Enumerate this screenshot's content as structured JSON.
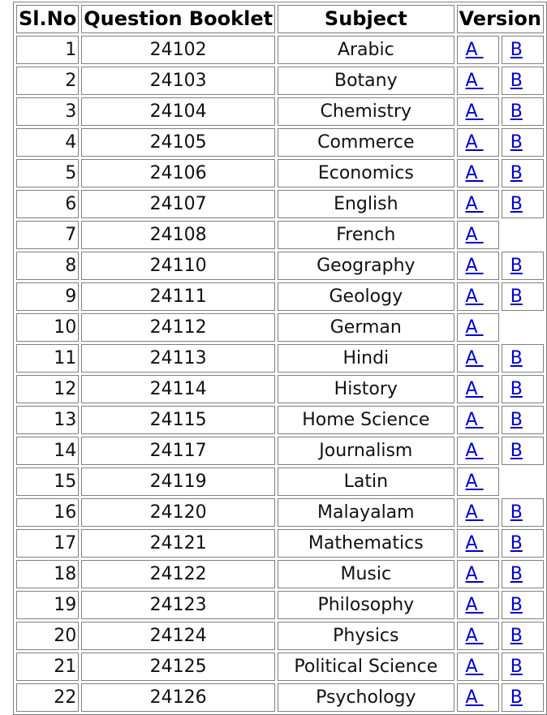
{
  "table": {
    "headers": {
      "sl_no": "Sl.No",
      "question_booklet": "Question Booklet",
      "subject": "Subject",
      "version": "Version"
    },
    "link_color": "#0000cc",
    "rows": [
      {
        "sl": "1",
        "booklet": "24102",
        "subject": "Arabic",
        "a": "A ",
        "b": "B"
      },
      {
        "sl": "2",
        "booklet": "24103",
        "subject": "Botany",
        "a": "A ",
        "b": "B"
      },
      {
        "sl": "3",
        "booklet": "24104",
        "subject": "Chemistry",
        "a": "A ",
        "b": "B"
      },
      {
        "sl": "4",
        "booklet": "24105",
        "subject": "Commerce",
        "a": "A ",
        "b": "B"
      },
      {
        "sl": "5",
        "booklet": "24106",
        "subject": "Economics",
        "a": "A ",
        "b": "B"
      },
      {
        "sl": "6",
        "booklet": "24107",
        "subject": "English",
        "a": "A ",
        "b": "B"
      },
      {
        "sl": "7",
        "booklet": "24108",
        "subject": "French",
        "a": "A ",
        "b": null
      },
      {
        "sl": "8",
        "booklet": "24110",
        "subject": "Geography",
        "a": "A ",
        "b": "B"
      },
      {
        "sl": "9",
        "booklet": "24111",
        "subject": "Geology",
        "a": "A ",
        "b": "B"
      },
      {
        "sl": "10",
        "booklet": "24112",
        "subject": "German",
        "a": "A ",
        "b": null
      },
      {
        "sl": "11",
        "booklet": "24113",
        "subject": "Hindi",
        "a": "A ",
        "b": "B"
      },
      {
        "sl": "12",
        "booklet": "24114",
        "subject": "History",
        "a": "A ",
        "b": "B"
      },
      {
        "sl": "13",
        "booklet": "24115",
        "subject": "Home Science",
        "a": "A ",
        "b": "B"
      },
      {
        "sl": "14",
        "booklet": "24117",
        "subject": "Journalism",
        "a": "A ",
        "b": "B"
      },
      {
        "sl": "15",
        "booklet": "24119",
        "subject": "Latin",
        "a": "A ",
        "b": null
      },
      {
        "sl": "16",
        "booklet": "24120",
        "subject": "Malayalam",
        "a": "A ",
        "b": "B"
      },
      {
        "sl": "17",
        "booklet": "24121",
        "subject": "Mathematics",
        "a": "A ",
        "b": "B"
      },
      {
        "sl": "18",
        "booklet": "24122",
        "subject": "Music",
        "a": "A ",
        "b": "B"
      },
      {
        "sl": "19",
        "booklet": "24123",
        "subject": "Philosophy",
        "a": "A ",
        "b": "B"
      },
      {
        "sl": "20",
        "booklet": "24124",
        "subject": "Physics",
        "a": "A ",
        "b": "B"
      },
      {
        "sl": "21",
        "booklet": "24125",
        "subject": "Political Science",
        "a": "A ",
        "b": "B"
      },
      {
        "sl": "22",
        "booklet": "24126",
        "subject": "Psychology",
        "a": "A ",
        "b": "B"
      }
    ]
  }
}
